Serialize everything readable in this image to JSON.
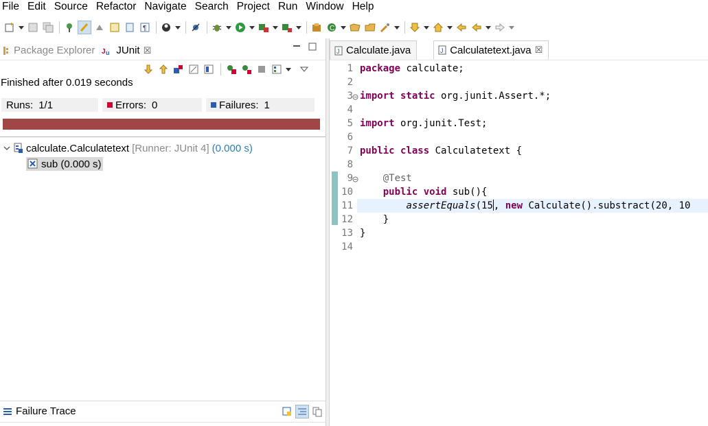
{
  "menu": [
    "File",
    "Edit",
    "Source",
    "Refactor",
    "Navigate",
    "Search",
    "Project",
    "Run",
    "Window",
    "Help"
  ],
  "left_view": {
    "tabs": [
      {
        "label": "Package Explorer",
        "icon": "package-explorer-icon",
        "active": false
      },
      {
        "label": "JUnit",
        "icon": "junit-icon",
        "active": true,
        "close": "☒"
      }
    ],
    "status": "Finished after 0.019 seconds",
    "runs_label": "Runs:",
    "runs_value": "1/1",
    "errors_label": "Errors:",
    "errors_value": "0",
    "failures_label": "Failures:",
    "failures_value": "1",
    "progress_color": "#a14646",
    "tree": {
      "root": {
        "name": "calculate.Calculatetext",
        "runner": "[Runner: JUnit 4]",
        "time": "(0.000 s)"
      },
      "child": {
        "name": "sub (0.000 s)"
      }
    },
    "failure_trace_label": "Failure Trace"
  },
  "editor": {
    "tabs": [
      {
        "label": "Calculate.java",
        "active": false
      },
      {
        "label": "Calculatetext.java",
        "active": true,
        "close": "☒"
      }
    ],
    "line_numbers": [
      "1",
      "2",
      "3",
      "4",
      "5",
      "6",
      "7",
      "8",
      "9",
      "10",
      "11",
      "12",
      "13",
      "14"
    ],
    "code": {
      "l1_kw": "package",
      "l1_rest": " calculate;",
      "l3_kw": "import static",
      "l3_rest": " org.junit.Assert.*;",
      "l5_kw": "import",
      "l5_rest": " org.junit.Test;",
      "l7_kw": "public class",
      "l7_rest": " Calculatetext {",
      "l9_ann": "    @Test",
      "l10_kw": "    public void",
      "l10_rest": " sub(){",
      "l11_indent": "        ",
      "l11_call": "assertEquals",
      "l11_arg": "(15",
      "l11_after": ", ",
      "l11_kw": "new",
      "l11_rest": " Calculate().substract(20, 10",
      "l12": "    }",
      "l13": "}"
    },
    "colors": {
      "keyword": "#7f0055",
      "annotation": "#646464",
      "current_line": "#e8f2fe"
    }
  }
}
